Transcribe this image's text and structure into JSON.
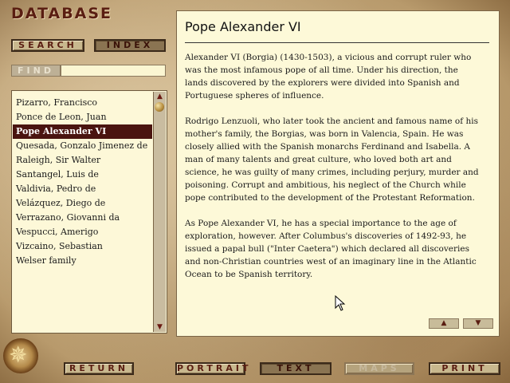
{
  "app": {
    "title": "DATABASE"
  },
  "nav": {
    "search_label": "SEARCH",
    "index_label": "INDEX"
  },
  "find": {
    "label": "FIND",
    "value": ""
  },
  "list": {
    "items": [
      "Pizarro, Francisco",
      "Ponce de Leon, Juan",
      "Pope Alexander VI",
      "Quesada, Gonzalo Jimenez de",
      "Raleigh, Sir Walter",
      "Santangel, Luis de",
      "Valdivia, Pedro de",
      "Velázquez, Diego de",
      "Verrazano, Giovanni da",
      "Vespucci, Amerigo",
      "Vizcaino, Sebastian",
      "Welser family"
    ],
    "selected": "Pope Alexander VI"
  },
  "article": {
    "title": "Pope Alexander VI",
    "paragraphs": [
      "Alexander VI (Borgia) (1430-1503), a vicious and corrupt ruler who was the most infamous pope of all time. Under his direction, the lands discovered by the explorers were divided into Spanish and Portuguese spheres of influence.",
      "Rodrigo Lenzuoli, who later took the ancient and famous name of his mother's family, the Borgias, was born in Valencia, Spain. He was closely allied with the Spanish monarchs Ferdinand and Isabella. A man of many talents and great culture, who loved both art and science, he was guilty of many crimes, including perjury, murder and poisoning. Corrupt and ambitious, his neglect of the Church while pope contributed to the development of the Protestant Reformation.",
      "As Pope Alexander VI, he has a special importance to the age of exploration, however. After Columbus's discoveries of 1492-93, he issued a papal bull (\"Inter Caetera\") which declared all discoveries and non-Christian countries west of an imaginary line in the Atlantic Ocean to be Spanish territory."
    ]
  },
  "toolbar": {
    "return_label": "RETURN",
    "portrait_label": "PORTRAIT",
    "text_label": "TEXT",
    "maps_label": "MAPS",
    "print_label": "PRINT"
  },
  "icons": {
    "page_up": "triangle-up-icon",
    "page_down": "triangle-down-icon",
    "scroll_up": "triangle-up-icon",
    "scroll_down": "triangle-down-icon",
    "logo": "compass-rose-icon"
  },
  "colors": {
    "title": "#5a1e12",
    "selected_bg": "#4a1410",
    "panel_bg": "#fdf9d8"
  }
}
